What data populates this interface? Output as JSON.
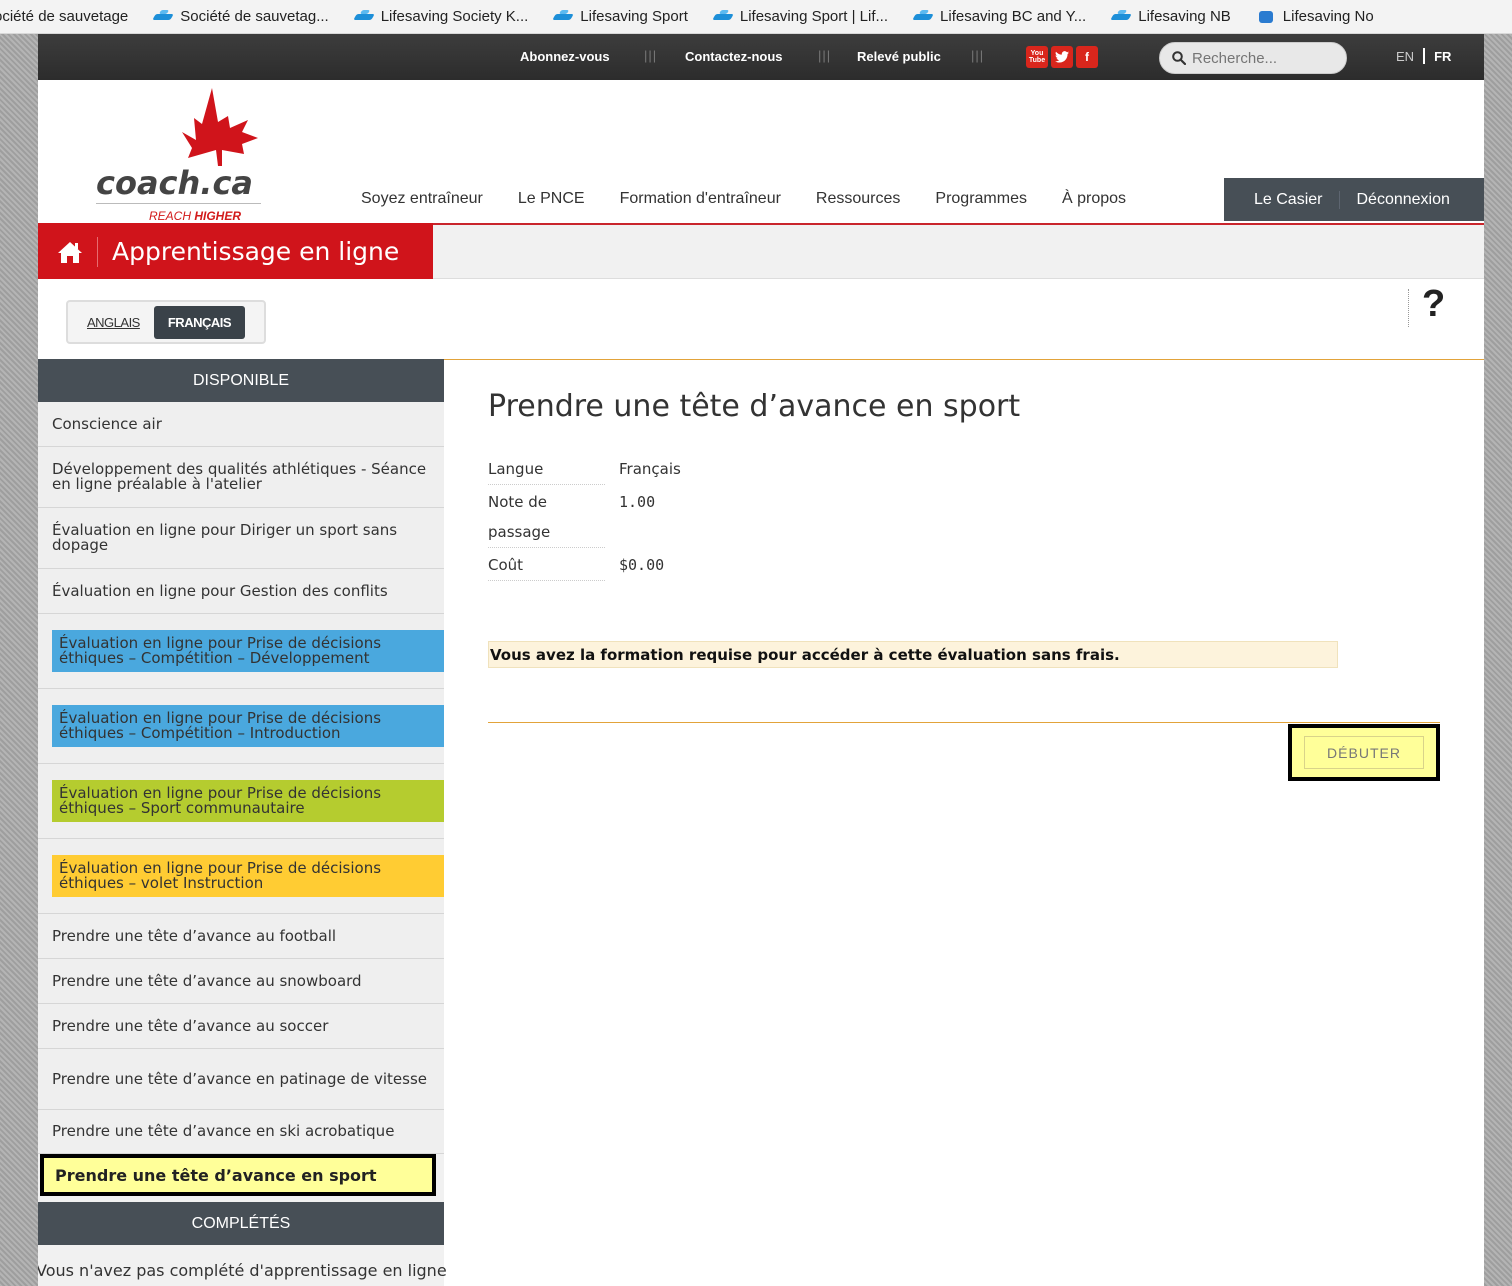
{
  "bookmarks": [
    {
      "label": "ociété de sauvetage"
    },
    {
      "label": "Société de sauvetag..."
    },
    {
      "label": "Lifesaving Society  K..."
    },
    {
      "label": "Lifesaving Sport"
    },
    {
      "label": "Lifesaving Sport | Lif..."
    },
    {
      "label": "Lifesaving BC and Y..."
    },
    {
      "label": "Lifesaving NB"
    },
    {
      "label": "Lifesaving No"
    }
  ],
  "utility": {
    "subscribe": "Abonnez-vous",
    "contact": "Contactez-nous",
    "public_record": "Relevé public",
    "separator": "|||",
    "social": [
      {
        "icon": "youtube-icon",
        "text": "You Tube"
      },
      {
        "icon": "twitter-icon",
        "text": "t"
      },
      {
        "icon": "facebook-icon",
        "text": "f"
      }
    ],
    "search_placeholder": "Recherche...",
    "lang_en": "EN",
    "lang_fr": "FR"
  },
  "logo": {
    "name": "coach.ca",
    "tagline_pre": "REACH ",
    "tagline_bold": "HIGHER"
  },
  "nav": {
    "items": [
      "Soyez entraîneur",
      "Le PNCE",
      "Formation d'entraîneur",
      "Ressources",
      "Programmes",
      "À propos"
    ],
    "locker": "Le Casier",
    "logout": "Déconnexion"
  },
  "banner": {
    "title": "Apprentissage en ligne"
  },
  "language": {
    "english": "ANGLAIS",
    "french": "FRANÇAIS",
    "help": "?"
  },
  "sidebar": {
    "available_title": "DISPONIBLE",
    "items": [
      {
        "label": "Conscience air"
      },
      {
        "label": "Développement des qualités athlétiques - Séance en ligne préalable à l'atelier"
      },
      {
        "label": "Évaluation en ligne pour Diriger un sport sans dopage"
      },
      {
        "label": "Évaluation en ligne pour Gestion des conflits"
      },
      {
        "label": "Évaluation en ligne pour Prise de décisions éthiques – Compétition – Développement",
        "color": "#4aa8de"
      },
      {
        "label": "Évaluation en ligne pour Prise de décisions éthiques – Compétition – Introduction",
        "color": "#4aa8de"
      },
      {
        "label": "Évaluation en ligne pour Prise de décisions éthiques – Sport communautaire",
        "color": "#b5cc2f"
      },
      {
        "label": "Évaluation en ligne pour Prise de décisions éthiques – volet Instruction",
        "color": "#ffcc33"
      },
      {
        "label": "Prendre une tête d’avance au football"
      },
      {
        "label": "Prendre une tête d’avance au snowboard"
      },
      {
        "label": "Prendre une tête d’avance au soccer"
      },
      {
        "label": "Prendre une tête d’avance en patinage de vitesse"
      },
      {
        "label": "Prendre une tête d’avance en ski acrobatique"
      }
    ],
    "selected": "Prendre une tête d’avance en sport",
    "completed_title": "COMPLÉTÉS",
    "completed_empty": "Vous n'avez pas complété d'apprentissage en ligne"
  },
  "main": {
    "title": "Prendre une tête d’avance en sport",
    "info": {
      "language_key": "Langue",
      "language_val": "Français",
      "pass_key": "Note de passage",
      "pass_val": "1.00",
      "cost_key": "Coût",
      "cost_val": "$0.00"
    },
    "notice": "Vous avez la formation requise pour accéder à cette évaluation sans frais.",
    "start": "DÉBUTER"
  },
  "colors": {
    "brand_red": "#d0141b",
    "dark": "#474f56",
    "accent_orange": "#e2a33a",
    "highlight": "#ffff99"
  }
}
